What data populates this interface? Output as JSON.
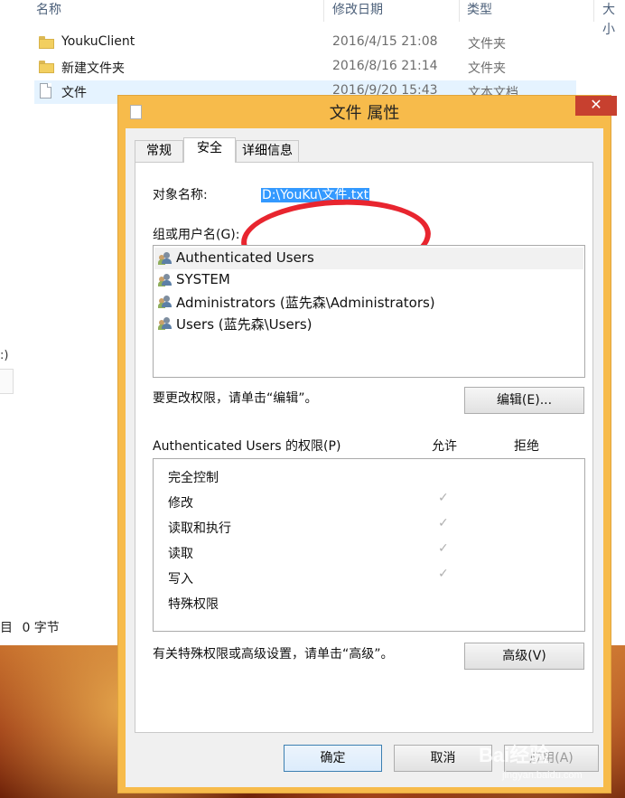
{
  "explorer": {
    "columns": {
      "name": "名称",
      "date": "修改日期",
      "type": "类型",
      "size": "大小"
    },
    "files": [
      {
        "name": "YoukuClient",
        "date": "2016/4/15 21:08",
        "type": "文件夹",
        "icon": "folder-icon"
      },
      {
        "name": "新建文件夹",
        "date": "2016/8/16 21:14",
        "type": "文件夹",
        "icon": "folder-icon"
      },
      {
        "name": "文件",
        "date": "2016/9/20 15:43",
        "type": "文本文档",
        "icon": "text-file-icon"
      }
    ],
    "left_fragment": ":)",
    "status": {
      "items": "目",
      "size": "0 字节"
    }
  },
  "dialog": {
    "title": "文件 属性",
    "close_label": "✕",
    "tabs": [
      {
        "label": "常规",
        "active": false
      },
      {
        "label": "安全",
        "active": true
      },
      {
        "label": "详细信息",
        "active": false
      }
    ],
    "object_name_label": "对象名称:",
    "object_name_value": "D:\\YouKu\\文件.txt",
    "groups_label": "组或用户名(G):",
    "users": [
      {
        "name": "Authenticated Users",
        "selected": true
      },
      {
        "name": "SYSTEM",
        "selected": false
      },
      {
        "name": "Administrators (蓝先森\\Administrators)",
        "selected": false
      },
      {
        "name": "Users (蓝先森\\Users)",
        "selected": false
      }
    ],
    "edit_hint": "要更改权限，请单击“编辑”。",
    "edit_button": "编辑(E)...",
    "permissions_label": "Authenticated Users 的权限(P)",
    "allow_header": "允许",
    "deny_header": "拒绝",
    "permissions": [
      {
        "name": "完全控制",
        "allow": false,
        "deny": false
      },
      {
        "name": "修改",
        "allow": true,
        "deny": false
      },
      {
        "name": "读取和执行",
        "allow": true,
        "deny": false
      },
      {
        "name": "读取",
        "allow": true,
        "deny": false
      },
      {
        "name": "写入",
        "allow": true,
        "deny": false
      },
      {
        "name": "特殊权限",
        "allow": false,
        "deny": false
      }
    ],
    "check_glyph": "✓",
    "advanced_hint": "有关特殊权限或高级设置，请单击“高级”。",
    "advanced_button": "高级(V)",
    "ok_button": "确定",
    "cancel_button": "取消",
    "apply_button": "应用(A)"
  },
  "watermark": {
    "brand": "Bai经验",
    "url": "jingyan.baidu.com"
  },
  "colors": {
    "dialog_frame": "#f7bb4b",
    "close_button": "#c7402f",
    "selection_highlight": "#3399ff",
    "annotation_circle": "#e8252f"
  }
}
